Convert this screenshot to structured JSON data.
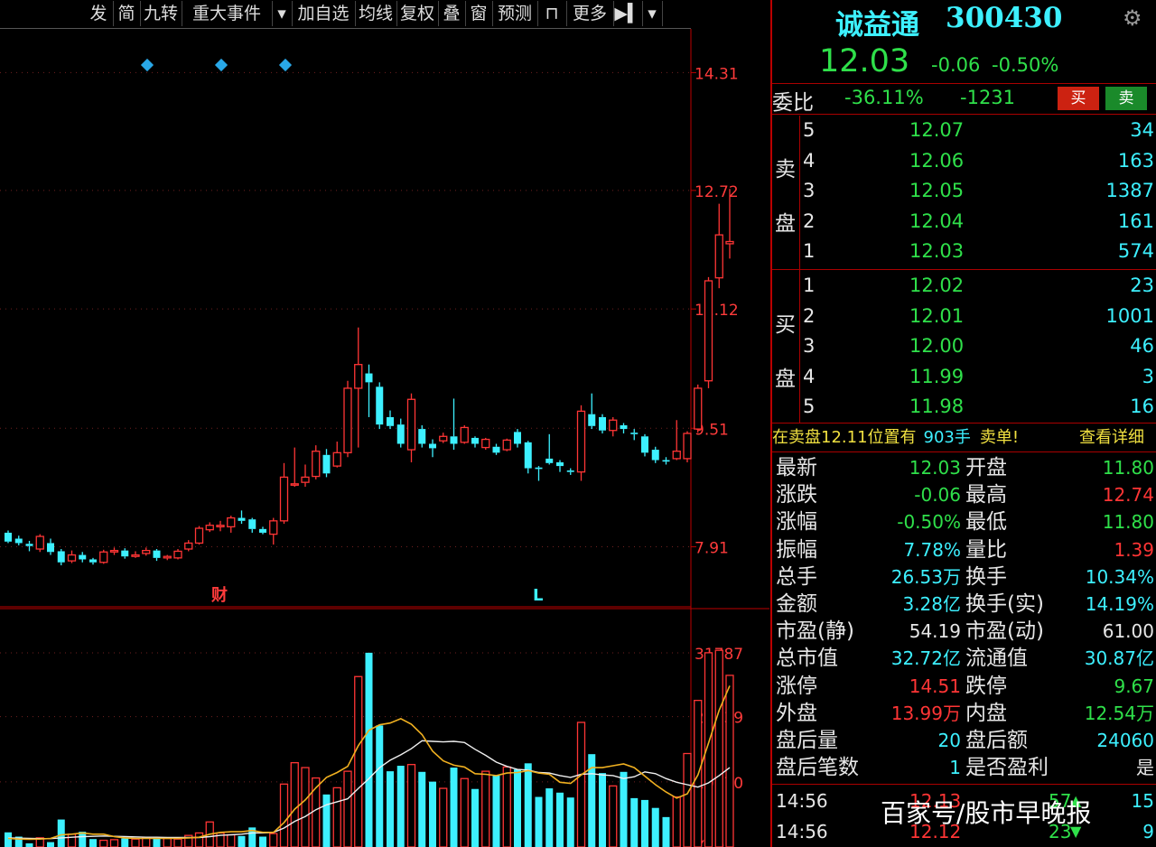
{
  "toolbar": {
    "items": [
      {
        "label": "发",
        "flag": false
      },
      {
        "label": "简",
        "flag": true
      },
      {
        "label": "九转",
        "flag": true
      },
      {
        "label": "重大事件",
        "flag": true
      },
      {
        "label": "▾",
        "flag": false
      },
      {
        "label": "加自选",
        "flag": false
      },
      {
        "label": "均线",
        "flag": false
      },
      {
        "label": "复权",
        "flag": false
      },
      {
        "label": "叠",
        "flag": false
      },
      {
        "label": "窗",
        "flag": false
      },
      {
        "label": "预测",
        "flag": false
      },
      {
        "label": "⊓",
        "flag": false
      },
      {
        "label": "更多",
        "flag": false
      },
      {
        "label": "▶▍",
        "flag": false
      },
      {
        "label": "▾",
        "flag": false
      }
    ]
  },
  "chart_data": {
    "type": "candlestick",
    "price_axis": {
      "labels": [
        "14.31",
        "12.72",
        "11.12",
        "9.51",
        "7.91"
      ],
      "ylim": [
        7.1,
        14.9
      ]
    },
    "volume_axis": {
      "labels": [
        "31787",
        "21339",
        "10670",
        "X10"
      ],
      "ylim": [
        0,
        34000
      ]
    },
    "markers": [
      {
        "text": "财",
        "color": "#ff3b3b"
      },
      {
        "text": "L",
        "color": "#3df0ff"
      }
    ],
    "candles": [
      {
        "o": 8.1,
        "c": 7.98,
        "h": 8.13,
        "l": 7.96
      },
      {
        "o": 8.02,
        "c": 7.96,
        "h": 8.06,
        "l": 7.93
      },
      {
        "o": 7.95,
        "c": 7.92,
        "h": 7.99,
        "l": 7.85
      },
      {
        "o": 7.88,
        "c": 8.05,
        "h": 8.08,
        "l": 7.84
      },
      {
        "o": 7.96,
        "c": 7.84,
        "h": 8.02,
        "l": 7.8
      },
      {
        "o": 7.85,
        "c": 7.7,
        "h": 7.88,
        "l": 7.66
      },
      {
        "o": 7.72,
        "c": 7.8,
        "h": 7.86,
        "l": 7.69
      },
      {
        "o": 7.8,
        "c": 7.74,
        "h": 7.84,
        "l": 7.7
      },
      {
        "o": 7.74,
        "c": 7.7,
        "h": 7.76,
        "l": 7.67
      },
      {
        "o": 7.7,
        "c": 7.84,
        "h": 7.87,
        "l": 7.68
      },
      {
        "o": 7.84,
        "c": 7.86,
        "h": 7.9,
        "l": 7.8
      },
      {
        "o": 7.86,
        "c": 7.78,
        "h": 7.89,
        "l": 7.75
      },
      {
        "o": 7.78,
        "c": 7.8,
        "h": 7.85,
        "l": 7.76
      },
      {
        "o": 7.82,
        "c": 7.86,
        "h": 7.9,
        "l": 7.79
      },
      {
        "o": 7.86,
        "c": 7.76,
        "h": 7.88,
        "l": 7.72
      },
      {
        "o": 7.76,
        "c": 7.78,
        "h": 7.8,
        "l": 7.73
      },
      {
        "o": 7.76,
        "c": 7.85,
        "h": 7.88,
        "l": 7.74
      },
      {
        "o": 7.88,
        "c": 7.96,
        "h": 8.0,
        "l": 7.85
      },
      {
        "o": 7.96,
        "c": 8.16,
        "h": 8.19,
        "l": 7.94
      },
      {
        "o": 8.14,
        "c": 8.2,
        "h": 8.24,
        "l": 8.11
      },
      {
        "o": 8.18,
        "c": 8.2,
        "h": 8.26,
        "l": 8.12
      },
      {
        "o": 8.18,
        "c": 8.3,
        "h": 8.33,
        "l": 8.1
      },
      {
        "o": 8.3,
        "c": 8.26,
        "h": 8.4,
        "l": 8.22
      },
      {
        "o": 8.28,
        "c": 8.15,
        "h": 8.3,
        "l": 8.1
      },
      {
        "o": 8.15,
        "c": 8.1,
        "h": 8.18,
        "l": 8.08
      },
      {
        "o": 8.08,
        "c": 8.26,
        "h": 8.3,
        "l": 7.94
      },
      {
        "o": 8.26,
        "c": 8.85,
        "h": 9.04,
        "l": 8.22
      },
      {
        "o": 8.76,
        "c": 8.76,
        "h": 9.25,
        "l": 8.72
      },
      {
        "o": 8.78,
        "c": 8.85,
        "h": 9.02,
        "l": 8.72
      },
      {
        "o": 8.86,
        "c": 9.2,
        "h": 9.28,
        "l": 8.82
      },
      {
        "o": 9.15,
        "c": 8.9,
        "h": 9.23,
        "l": 8.85
      },
      {
        "o": 9.0,
        "c": 9.18,
        "h": 9.33,
        "l": 8.98
      },
      {
        "o": 9.18,
        "c": 10.05,
        "h": 10.15,
        "l": 9.12
      },
      {
        "o": 10.05,
        "c": 10.37,
        "h": 10.87,
        "l": 9.25
      },
      {
        "o": 10.25,
        "c": 10.13,
        "h": 10.37,
        "l": 9.66
      },
      {
        "o": 10.07,
        "c": 9.56,
        "h": 10.13,
        "l": 9.5
      },
      {
        "o": 9.66,
        "c": 9.54,
        "h": 9.75,
        "l": 9.5
      },
      {
        "o": 9.56,
        "c": 9.3,
        "h": 9.64,
        "l": 9.25
      },
      {
        "o": 9.22,
        "c": 9.9,
        "h": 9.98,
        "l": 9.05
      },
      {
        "o": 9.5,
        "c": 9.3,
        "h": 9.55,
        "l": 9.25
      },
      {
        "o": 9.3,
        "c": 9.24,
        "h": 9.36,
        "l": 9.12
      },
      {
        "o": 9.34,
        "c": 9.4,
        "h": 9.45,
        "l": 9.31
      },
      {
        "o": 9.4,
        "c": 9.3,
        "h": 9.91,
        "l": 9.22
      },
      {
        "o": 9.32,
        "c": 9.52,
        "h": 9.55,
        "l": 9.3
      },
      {
        "o": 9.38,
        "c": 9.3,
        "h": 9.4,
        "l": 9.25
      },
      {
        "o": 9.25,
        "c": 9.36,
        "h": 9.38,
        "l": 9.22
      },
      {
        "o": 9.26,
        "c": 9.18,
        "h": 9.3,
        "l": 9.15
      },
      {
        "o": 9.22,
        "c": 9.35,
        "h": 9.37,
        "l": 9.2
      },
      {
        "o": 9.46,
        "c": 9.3,
        "h": 9.5,
        "l": 9.25
      },
      {
        "o": 9.32,
        "c": 8.97,
        "h": 9.34,
        "l": 8.9
      },
      {
        "o": 8.98,
        "c": 8.96,
        "h": 9.0,
        "l": 8.8
      },
      {
        "o": 9.1,
        "c": 9.04,
        "h": 9.43,
        "l": 9.02
      },
      {
        "o": 9.05,
        "c": 9.0,
        "h": 9.08,
        "l": 8.92
      },
      {
        "o": 8.94,
        "c": 8.92,
        "h": 8.97,
        "l": 8.88
      },
      {
        "o": 8.92,
        "c": 9.74,
        "h": 9.82,
        "l": 8.8
      },
      {
        "o": 9.7,
        "c": 9.54,
        "h": 9.98,
        "l": 9.5
      },
      {
        "o": 9.66,
        "c": 9.48,
        "h": 9.7,
        "l": 9.44
      },
      {
        "o": 9.48,
        "c": 9.62,
        "h": 9.66,
        "l": 9.4
      },
      {
        "o": 9.55,
        "c": 9.5,
        "h": 9.58,
        "l": 9.44
      },
      {
        "o": 9.45,
        "c": 9.43,
        "h": 9.5,
        "l": 9.35
      },
      {
        "o": 9.4,
        "c": 9.18,
        "h": 9.43,
        "l": 9.13
      },
      {
        "o": 9.22,
        "c": 9.08,
        "h": 9.26,
        "l": 9.04
      },
      {
        "o": 9.08,
        "c": 9.06,
        "h": 9.12,
        "l": 9.02
      },
      {
        "o": 9.1,
        "c": 9.2,
        "h": 9.62,
        "l": 9.08
      },
      {
        "o": 9.1,
        "c": 9.44,
        "h": 9.47,
        "l": 9.05
      },
      {
        "o": 9.5,
        "c": 10.05,
        "h": 10.1,
        "l": 9.45
      },
      {
        "o": 10.15,
        "c": 11.5,
        "h": 11.55,
        "l": 10.05
      },
      {
        "o": 11.54,
        "c": 12.12,
        "h": 12.54,
        "l": 11.4
      },
      {
        "o": 12.0,
        "c": 12.03,
        "h": 12.74,
        "l": 11.8
      }
    ],
    "volumes": [
      2400,
      1700,
      600,
      1500,
      800,
      4500,
      2100,
      2500,
      1300,
      1100,
      1200,
      1400,
      1300,
      1600,
      1500,
      1400,
      1300,
      1900,
      2300,
      4100,
      2300,
      2000,
      1800,
      3200,
      1700,
      2200,
      10300,
      13800,
      13000,
      11300,
      8600,
      9700,
      12400,
      27900,
      31800,
      19900,
      12400,
      13300,
      13500,
      12300,
      10700,
      9600,
      13000,
      11200,
      9500,
      12400,
      11700,
      13100,
      12700,
      13700,
      8200,
      9600,
      8900,
      8100,
      20400,
      15200,
      12100,
      10000,
      12300,
      8000,
      7700,
      6400,
      4900,
      8200,
      15300,
      24000,
      31800,
      32200,
      28100
    ],
    "ma5": [
      1400,
      1300,
      1250,
      1300,
      1400,
      2000,
      2100,
      2300,
      2100,
      2100,
      1700,
      1500,
      1400,
      1400,
      1400,
      1400,
      1400,
      1500,
      1600,
      2100,
      2400,
      2500,
      2500,
      2700,
      2400,
      2400,
      4000,
      6200,
      7700,
      9700,
      11400,
      12200,
      13200,
      16600,
      19100,
      20000,
      20300,
      21000,
      20100,
      18400,
      15700,
      14100,
      13400,
      13100,
      12000,
      11900,
      11700,
      12100,
      12200,
      12500,
      12100,
      11900,
      10600,
      10400,
      11800,
      13000,
      13000,
      13300,
      13600,
      13000,
      11600,
      10200,
      9000,
      8000,
      8700,
      11800,
      17000,
      22400,
      26400
    ],
    "ma10": [
      1500,
      1450,
      1400,
      1380,
      1380,
      1500,
      1600,
      1700,
      1750,
      1800,
      1750,
      1700,
      1650,
      1600,
      1600,
      1550,
      1550,
      1550,
      1550,
      1700,
      1900,
      2000,
      2100,
      2300,
      2300,
      2400,
      3100,
      4200,
      5000,
      6100,
      6900,
      7400,
      7900,
      9600,
      11200,
      13000,
      14200,
      15100,
      16100,
      17400,
      17300,
      17200,
      17300,
      17100,
      16000,
      15000,
      13900,
      13200,
      12700,
      12600,
      12200,
      12100,
      11700,
      11400,
      11900,
      12000,
      11800,
      11700,
      11200,
      11500,
      12300,
      12000,
      11200,
      10600,
      10200,
      9800,
      10500,
      11700,
      13000
    ]
  },
  "quote": {
    "name": "诚益通",
    "code": "300430",
    "price": "12.03",
    "change": "-0.06",
    "change_pct": "-0.50%"
  },
  "weibi": {
    "label": "委比",
    "pct": "-36.11%",
    "diff": "-1231",
    "buy": "买",
    "sell": "卖"
  },
  "sell_orders": {
    "label_top": "卖",
    "label_bottom": "盘",
    "rows": [
      {
        "level": "5",
        "price": "12.07",
        "vol": "34"
      },
      {
        "level": "4",
        "price": "12.06",
        "vol": "163"
      },
      {
        "level": "3",
        "price": "12.05",
        "vol": "1387"
      },
      {
        "level": "2",
        "price": "12.04",
        "vol": "161"
      },
      {
        "level": "1",
        "price": "12.03",
        "vol": "574"
      }
    ]
  },
  "buy_orders": {
    "label_top": "买",
    "label_bottom": "盘",
    "rows": [
      {
        "level": "1",
        "price": "12.02",
        "vol": "23"
      },
      {
        "level": "2",
        "price": "12.01",
        "vol": "1001"
      },
      {
        "level": "3",
        "price": "12.00",
        "vol": "46"
      },
      {
        "level": "4",
        "price": "11.99",
        "vol": "3"
      },
      {
        "level": "5",
        "price": "11.98",
        "vol": "16"
      }
    ]
  },
  "notice": {
    "prefix": "在卖盘12.11位置有",
    "qty": "903手",
    "suffix": "卖单!",
    "link": "查看详细"
  },
  "stats": [
    {
      "l1": "最新",
      "v1": "12.03",
      "c1": "green",
      "l2": "开盘",
      "v2": "11.80",
      "c2": "green"
    },
    {
      "l1": "涨跌",
      "v1": "-0.06",
      "c1": "green",
      "l2": "最高",
      "v2": "12.74",
      "c2": "red"
    },
    {
      "l1": "涨幅",
      "v1": "-0.50%",
      "c1": "green",
      "l2": "最低",
      "v2": "11.80",
      "c2": "green"
    },
    {
      "l1": "振幅",
      "v1": "7.78%",
      "c1": "cyan",
      "l2": "量比",
      "v2": "1.39",
      "c2": "red"
    },
    {
      "l1": "总手",
      "v1": "26.53万",
      "c1": "cyan",
      "l2": "换手",
      "v2": "10.34%",
      "c2": "cyan"
    },
    {
      "l1": "金额",
      "v1": "3.28亿",
      "c1": "cyan",
      "l2": "换手(实)",
      "v2": "14.19%",
      "c2": "cyan"
    },
    {
      "l1": "市盈(静)",
      "v1": "54.19",
      "c1": "white",
      "l2": "市盈(动)",
      "v2": "61.00",
      "c2": "white"
    },
    {
      "l1": "总市值",
      "v1": "32.72亿",
      "c1": "cyan",
      "l2": "流通值",
      "v2": "30.87亿",
      "c2": "cyan"
    },
    {
      "l1": "涨停",
      "v1": "14.51",
      "c1": "red",
      "l2": "跌停",
      "v2": "9.67",
      "c2": "green"
    },
    {
      "l1": "外盘",
      "v1": "13.99万",
      "c1": "red",
      "l2": "内盘",
      "v2": "12.54万",
      "c2": "green"
    },
    {
      "l1": "盘后量",
      "v1": "20",
      "c1": "cyan",
      "l2": "盘后额",
      "v2": "24060",
      "c2": "cyan"
    },
    {
      "l1": "盘后笔数",
      "v1": "1",
      "c1": "cyan",
      "l2": "是否盈利",
      "v2": "是",
      "c2": "white"
    }
  ],
  "ticks": [
    {
      "time": "14:56",
      "price": "12.13",
      "vol": "57",
      "dir": "up",
      "num": "15"
    },
    {
      "time": "14:56",
      "price": "12.12",
      "vol": "23",
      "dir": "down",
      "num": "9"
    }
  ],
  "watermark": "百家号/股市早晚报"
}
